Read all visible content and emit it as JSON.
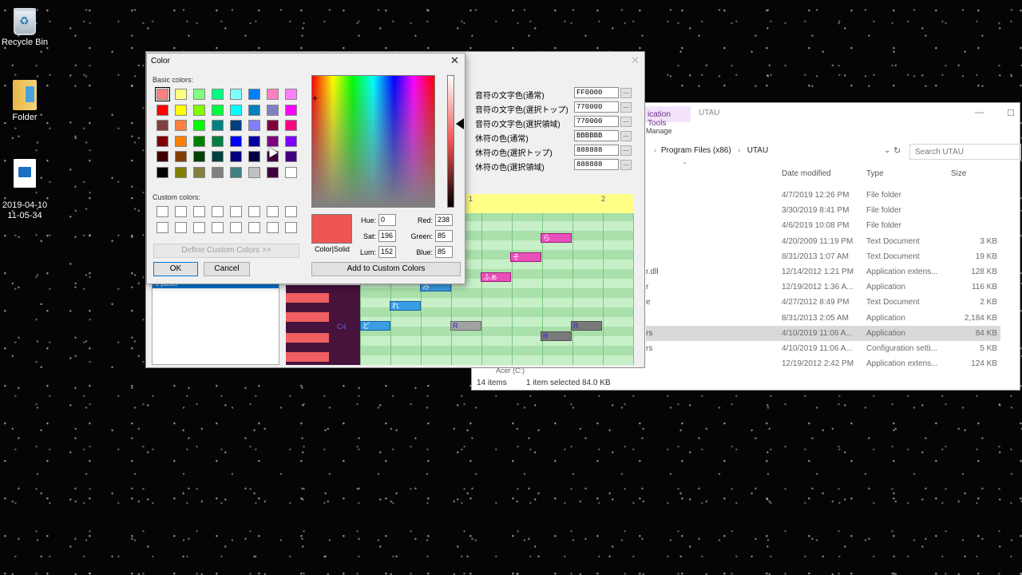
{
  "desktop": {
    "icons": [
      {
        "label": "Recycle Bin",
        "icon": "recycle-bin-icon"
      },
      {
        "label": "Folder",
        "icon": "folder-icon"
      },
      {
        "label": "2019-04-10\n11-05-34",
        "icon": "video-file-icon"
      }
    ]
  },
  "explorer": {
    "context_tab": "ication Tools",
    "manage": "Manage",
    "title": "UTAU",
    "address": [
      "Program Files (x86)",
      "UTAU"
    ],
    "search_placeholder": "Search UTAU",
    "columns": {
      "date": "Date modified",
      "type": "Type",
      "size": "Size"
    },
    "rows": [
      {
        "name": "",
        "date": "4/7/2019 12:26 PM",
        "type": "File folder",
        "size": ""
      },
      {
        "name": "",
        "date": "3/30/2019 8:41 PM",
        "type": "File folder",
        "size": ""
      },
      {
        "name": "",
        "date": "4/6/2019 10:08 PM",
        "type": "File folder",
        "size": ""
      },
      {
        "name": "",
        "date": "4/20/2009 11:19 PM",
        "type": "Text Document",
        "size": "3 KB"
      },
      {
        "name": "",
        "date": "8/31/2013 1:07 AM",
        "type": "Text Document",
        "size": "19 KB"
      },
      {
        "name": "r.dll",
        "date": "12/14/2012 1:21 PM",
        "type": "Application extens...",
        "size": "128 KB"
      },
      {
        "name": "r",
        "date": "12/19/2012 1:36 A...",
        "type": "Application",
        "size": "116 KB"
      },
      {
        "name": "e",
        "date": "4/27/2012 8:49 PM",
        "type": "Text Document",
        "size": "2 KB"
      },
      {
        "name": "",
        "date": "8/31/2013 2:05 AM",
        "type": "Application",
        "size": "2,184 KB"
      },
      {
        "name": "rs",
        "date": "4/10/2019 11:06 A...",
        "type": "Application",
        "size": "84 KB"
      },
      {
        "name": "rs",
        "date": "4/10/2019 11:06 A...",
        "type": "Configuration setti...",
        "size": "5 KB"
      },
      {
        "name": "",
        "date": "12/19/2012 2:42 PM",
        "type": "Application extens...",
        "size": "124 KB"
      }
    ],
    "selected_row": 9,
    "drive_label": "Acer (C:)",
    "status": {
      "items": "14 items",
      "selected": "1 item selected  84.0 KB"
    }
  },
  "utau": {
    "settings": [
      {
        "label": "音符の文字色(通常)",
        "value": "FF0000"
      },
      {
        "label": "音符の文字色(選択トップ)",
        "value": "770000"
      },
      {
        "label": "音符の文字色(選択領域)",
        "value": "770000"
      },
      {
        "label": "休符の色(通常)",
        "value": "BBBBBB"
      },
      {
        "label": "休符の色(選択トップ)",
        "value": "888888"
      },
      {
        "label": "休符の色(選択領域)",
        "value": "888888"
      }
    ],
    "browse_label": "...",
    "measures": [
      "1",
      "2"
    ],
    "key_label": "C4",
    "list_item": "ﾕ  paster",
    "notes": [
      {
        "lyric": "ら",
        "color": "pink"
      },
      {
        "lyric": "そ",
        "color": "pink"
      },
      {
        "lyric": "ふぁ",
        "color": "pink"
      },
      {
        "lyric": "み",
        "color": "blue"
      },
      {
        "lyric": "れ",
        "color": "blue"
      },
      {
        "lyric": "ど",
        "color": "blue"
      },
      {
        "lyric": "R",
        "color": "gray"
      },
      {
        "lyric": "R",
        "color": "dgray"
      },
      {
        "lyric": "R",
        "color": "dgray"
      }
    ]
  },
  "color_dialog": {
    "title": "Color",
    "basic_label": "Basic colors:",
    "custom_label": "Custom colors:",
    "basic_colors": [
      "#ff8080",
      "#ffff80",
      "#80ff80",
      "#00ff80",
      "#80ffff",
      "#0080ff",
      "#ff80c0",
      "#ff80ff",
      "#ff0000",
      "#ffff00",
      "#80ff00",
      "#00ff40",
      "#00ffff",
      "#0080c0",
      "#8080c0",
      "#ff00ff",
      "#804040",
      "#ff8040",
      "#00ff00",
      "#008080",
      "#004080",
      "#8080ff",
      "#800040",
      "#ff0080",
      "#800000",
      "#ff8000",
      "#008000",
      "#008040",
      "#0000ff",
      "#0000a0",
      "#800080",
      "#8000ff",
      "#400000",
      "#804000",
      "#004000",
      "#004040",
      "#000080",
      "#000040",
      "#400040",
      "#400080",
      "#000000",
      "#808000",
      "#808040",
      "#808080",
      "#408080",
      "#c0c0c0",
      "#400040",
      "#ffffff"
    ],
    "selected_basic": 0,
    "custom_colors": [
      "#ffffff",
      "#ffffff",
      "#ffffff",
      "#ffffff",
      "#ffffff",
      "#ffffff",
      "#ffffff",
      "#ffffff",
      "#ffffff",
      "#ffffff",
      "#ffffff",
      "#ffffff",
      "#ffffff",
      "#ffffff",
      "#ffffff",
      "#ffffff"
    ],
    "define_custom": "Define Custom Colors >>",
    "ok": "OK",
    "cancel": "Cancel",
    "add_custom": "Add to Custom Colors",
    "preview_label": "Color|Solid",
    "current_color": "#ee5555",
    "hue_label": "Hue:",
    "hue": "0",
    "sat_label": "Sat:",
    "sat": "196",
    "lum_label": "Lum:",
    "lum": "152",
    "red_label": "Red:",
    "red": "238",
    "green_label": "Green:",
    "green": "85",
    "blue_label": "Blue:",
    "blue": "85"
  }
}
